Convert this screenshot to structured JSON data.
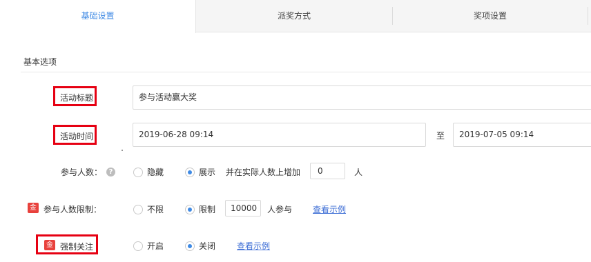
{
  "tabs": [
    {
      "label": "基础设置",
      "active": true
    },
    {
      "label": "派奖方式",
      "active": false
    },
    {
      "label": "奖项设置",
      "active": false
    }
  ],
  "section": {
    "title": "基本选项"
  },
  "title_field": {
    "label": "活动标题",
    "value": "参与活动赢大奖"
  },
  "time_field": {
    "label": "活动时间",
    "start": "2019-06-28 09:14",
    "separator": "至",
    "end": "2019-07-05 09:14"
  },
  "participants": {
    "label": "参与人数：",
    "options": [
      {
        "label": "隐藏",
        "checked": false
      },
      {
        "label": "展示",
        "checked": true
      }
    ],
    "increase_prefix": "并在实际人数上增加",
    "increase_value": "0",
    "increase_unit": "人"
  },
  "participant_limit": {
    "badge": "金",
    "label": "参与人数限制：",
    "options": [
      {
        "label": "不限",
        "checked": false
      },
      {
        "label": "限制",
        "checked": true
      }
    ],
    "limit_value": "10000",
    "limit_suffix": "人参与",
    "example_link": "查看示例"
  },
  "force_follow": {
    "badge": "金",
    "label": "强制关注",
    "options": [
      {
        "label": "开启",
        "checked": false
      },
      {
        "label": "关闭",
        "checked": true
      }
    ],
    "example_link": "查看示例"
  },
  "colors": {
    "accent": "#3f8ae4",
    "highlight_box": "#e60012",
    "badge": "#e8413c",
    "link": "#3f6fd6"
  }
}
